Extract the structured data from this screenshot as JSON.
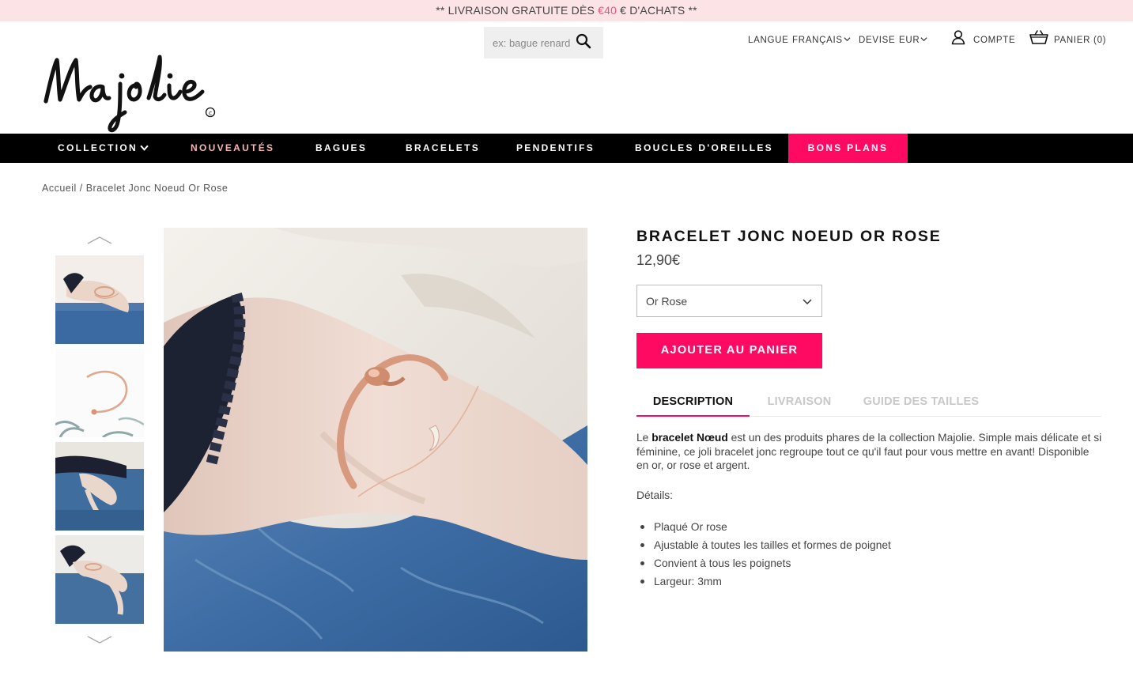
{
  "promo": {
    "prefix": "** LIVRAISON GRATUITE DÈS ",
    "amount": "€40",
    "suffix": " € D'ACHATS **"
  },
  "search": {
    "placeholder": "ex: bague renard"
  },
  "header": {
    "langue_label": "LANGUE",
    "langue_value": "FRANÇAIS",
    "devise_label": "DEVISE",
    "devise_value": "EUR",
    "account": "COMPTE",
    "cart": "PANIER (0)"
  },
  "logo": {
    "text": "Majolie",
    "mark": "©"
  },
  "nav": {
    "collection": "COLLECTION",
    "nouveautes": "NOUVEAUTÉS",
    "bagues": "BAGUES",
    "bracelets": "BRACELETS",
    "pendentifs": "PENDENTIFS",
    "boucles": "BOUCLES D'OREILLES",
    "bons_plans": "BONS PLANS"
  },
  "breadcrumb": {
    "home": "Accueil",
    "separator": " / ",
    "current": "Bracelet Jonc Noeud Or Rose"
  },
  "product": {
    "title": "BRACELET JONC NOEUD OR ROSE",
    "price": "12,90€",
    "variant": "Or Rose",
    "add_to_cart": "AJOUTER AU PANIER"
  },
  "tabs": {
    "description": "DESCRIPTION",
    "livraison": "LIVRAISON",
    "guide": "GUIDE DES TAILLES"
  },
  "description": {
    "intro": "Le ",
    "bold": "bracelet Nœud",
    "rest": " est un des produits phares de la collection Majolie. Simple mais délicate et si féminine, ce joli bracelet jonc regroupe tout ce qu'il faut pour vous mettre en avant! Disponible en or, or rose et argent.",
    "details_label": "Détails:",
    "bullets": [
      "Plaqué Or rose",
      "Ajustable à toutes les tailles et formes de poignet",
      "Convient à tous les poignets",
      "Largeur: 3mm"
    ]
  },
  "colors": {
    "accent": "#ff0a62",
    "promo_bg": "#fbe3e6",
    "nav_bg": "#000000",
    "nouveautes_text": "#f6b7b4"
  },
  "icons": {
    "search": "search-icon",
    "account": "user-icon",
    "cart": "basket-icon",
    "chevron": "chevron-down-icon"
  }
}
